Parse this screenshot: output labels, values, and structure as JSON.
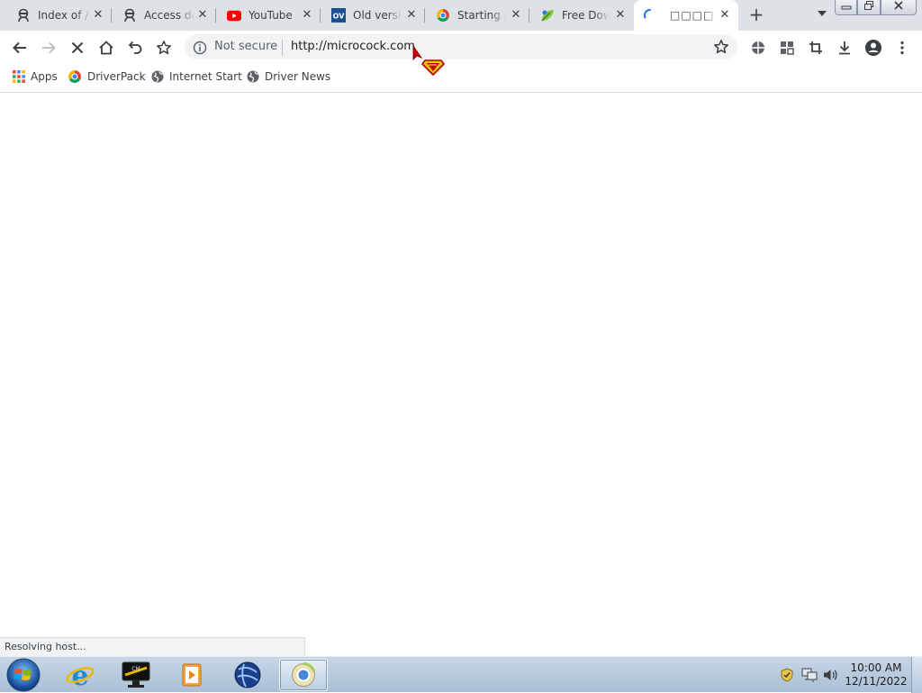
{
  "browser": {
    "tabs": [
      {
        "title": "Index of /",
        "favicon": "proxy-icon",
        "active": false
      },
      {
        "title": "Access denied",
        "favicon": "proxy-icon",
        "active": false
      },
      {
        "title": "YouTube",
        "favicon": "youtube-icon",
        "active": false
      },
      {
        "title": "Old version",
        "favicon": "oldversion-icon",
        "active": false
      },
      {
        "title": "Starting page",
        "favicon": "chrome-ball-icon",
        "active": false
      },
      {
        "title": "Free Download",
        "favicon": "leaf-icon",
        "active": false
      },
      {
        "title": "□□□□ □□",
        "favicon": "loading-spinner-icon",
        "active": true
      }
    ],
    "new_tab_label": "+",
    "omnibox": {
      "security_label": "Not secure",
      "url": "http://microcock.com"
    },
    "bookmarks": [
      {
        "label": "Apps",
        "icon": "apps-grid-icon"
      },
      {
        "label": "DriverPack",
        "icon": "driverpack-icon"
      },
      {
        "label": "Internet Start",
        "icon": "globe-icon"
      },
      {
        "label": "Driver News",
        "icon": "globe-icon"
      }
    ],
    "status_text": "Resolving host..."
  },
  "taskbar": {
    "items": [
      {
        "name": "internet-explorer-icon"
      },
      {
        "name": "pc-monitor-icon"
      },
      {
        "name": "media-player-icon"
      },
      {
        "name": "vpn-globe-icon"
      },
      {
        "name": "chromium-browser-icon"
      }
    ],
    "clock": {
      "time": "10:00 AM",
      "date": "12/11/2022"
    }
  },
  "colors": {
    "tabstrip": "#dee1e6",
    "omnibox": "#f1f3f4",
    "youtube_red": "#ff0000",
    "taskbar": "#b5c8dc"
  }
}
